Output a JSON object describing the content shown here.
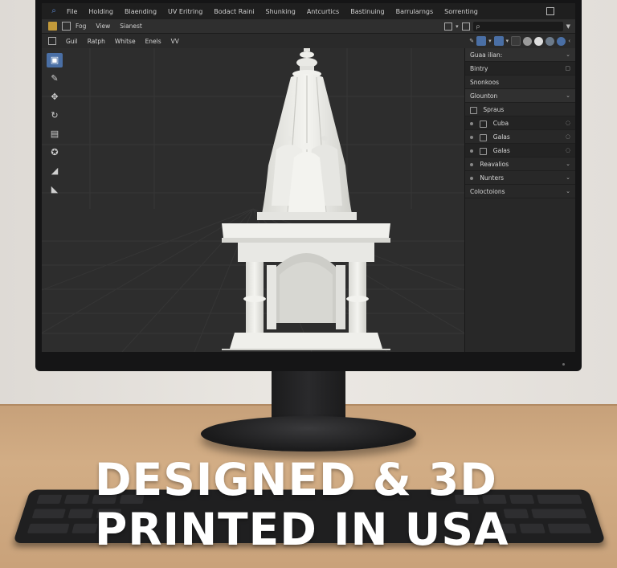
{
  "menu": {
    "items": [
      "File",
      "Holding",
      "Blaending",
      "UV Eritring",
      "Bodact Raini",
      "Shunking",
      "Antcurtics",
      "Bastinuing",
      "Barrularngs",
      "Sorrenting"
    ]
  },
  "header2": {
    "items": [
      "Fog",
      "View",
      "Sianest"
    ],
    "search_placeholder": "ρ"
  },
  "header3": {
    "items": [
      "Guil",
      "Ratph",
      "Whitse",
      "Enels",
      "VV"
    ]
  },
  "outliner": {
    "title": "Guaa ilian:",
    "rows": [
      {
        "label": "Bintry",
        "style": "dark"
      },
      {
        "label": "Snonkoos",
        "style": "normal"
      },
      {
        "label": "Glounton",
        "style": "head"
      },
      {
        "label": "Spraus",
        "style": "normal"
      },
      {
        "label": "Cuba",
        "style": "dark"
      },
      {
        "label": "Galas",
        "style": "normal"
      },
      {
        "label": "Galas",
        "style": "dark"
      },
      {
        "label": "Reavalios",
        "style": "normal"
      },
      {
        "label": "Nunters",
        "style": "normal"
      },
      {
        "label": "Coloctoions",
        "style": "normal"
      }
    ]
  },
  "headline": {
    "line1": "DESIGNED & 3D",
    "line2": "PRINTED IN USA"
  },
  "colors": {
    "accent": "#4a6fa5",
    "model": "#eeeeea"
  }
}
